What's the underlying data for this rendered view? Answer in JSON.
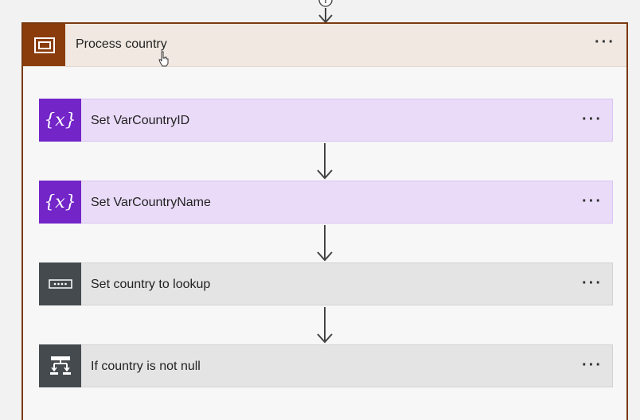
{
  "scope": {
    "title": "Process country",
    "accent": "#8a3c0c",
    "more_label": "···"
  },
  "actions": [
    {
      "label": "Set VarCountryID",
      "icon": "variable-icon",
      "glyph": "{x}",
      "color": "#7325c8",
      "more_label": "···"
    },
    {
      "label": "Set VarCountryName",
      "icon": "variable-icon",
      "glyph": "{x}",
      "color": "#7325c8",
      "more_label": "···"
    },
    {
      "label": "Set country to lookup",
      "icon": "compose-icon",
      "color": "#454a4f",
      "more_label": "···"
    },
    {
      "label": "If country is not null",
      "icon": "condition-icon",
      "color": "#454a4f",
      "more_label": "···"
    }
  ]
}
